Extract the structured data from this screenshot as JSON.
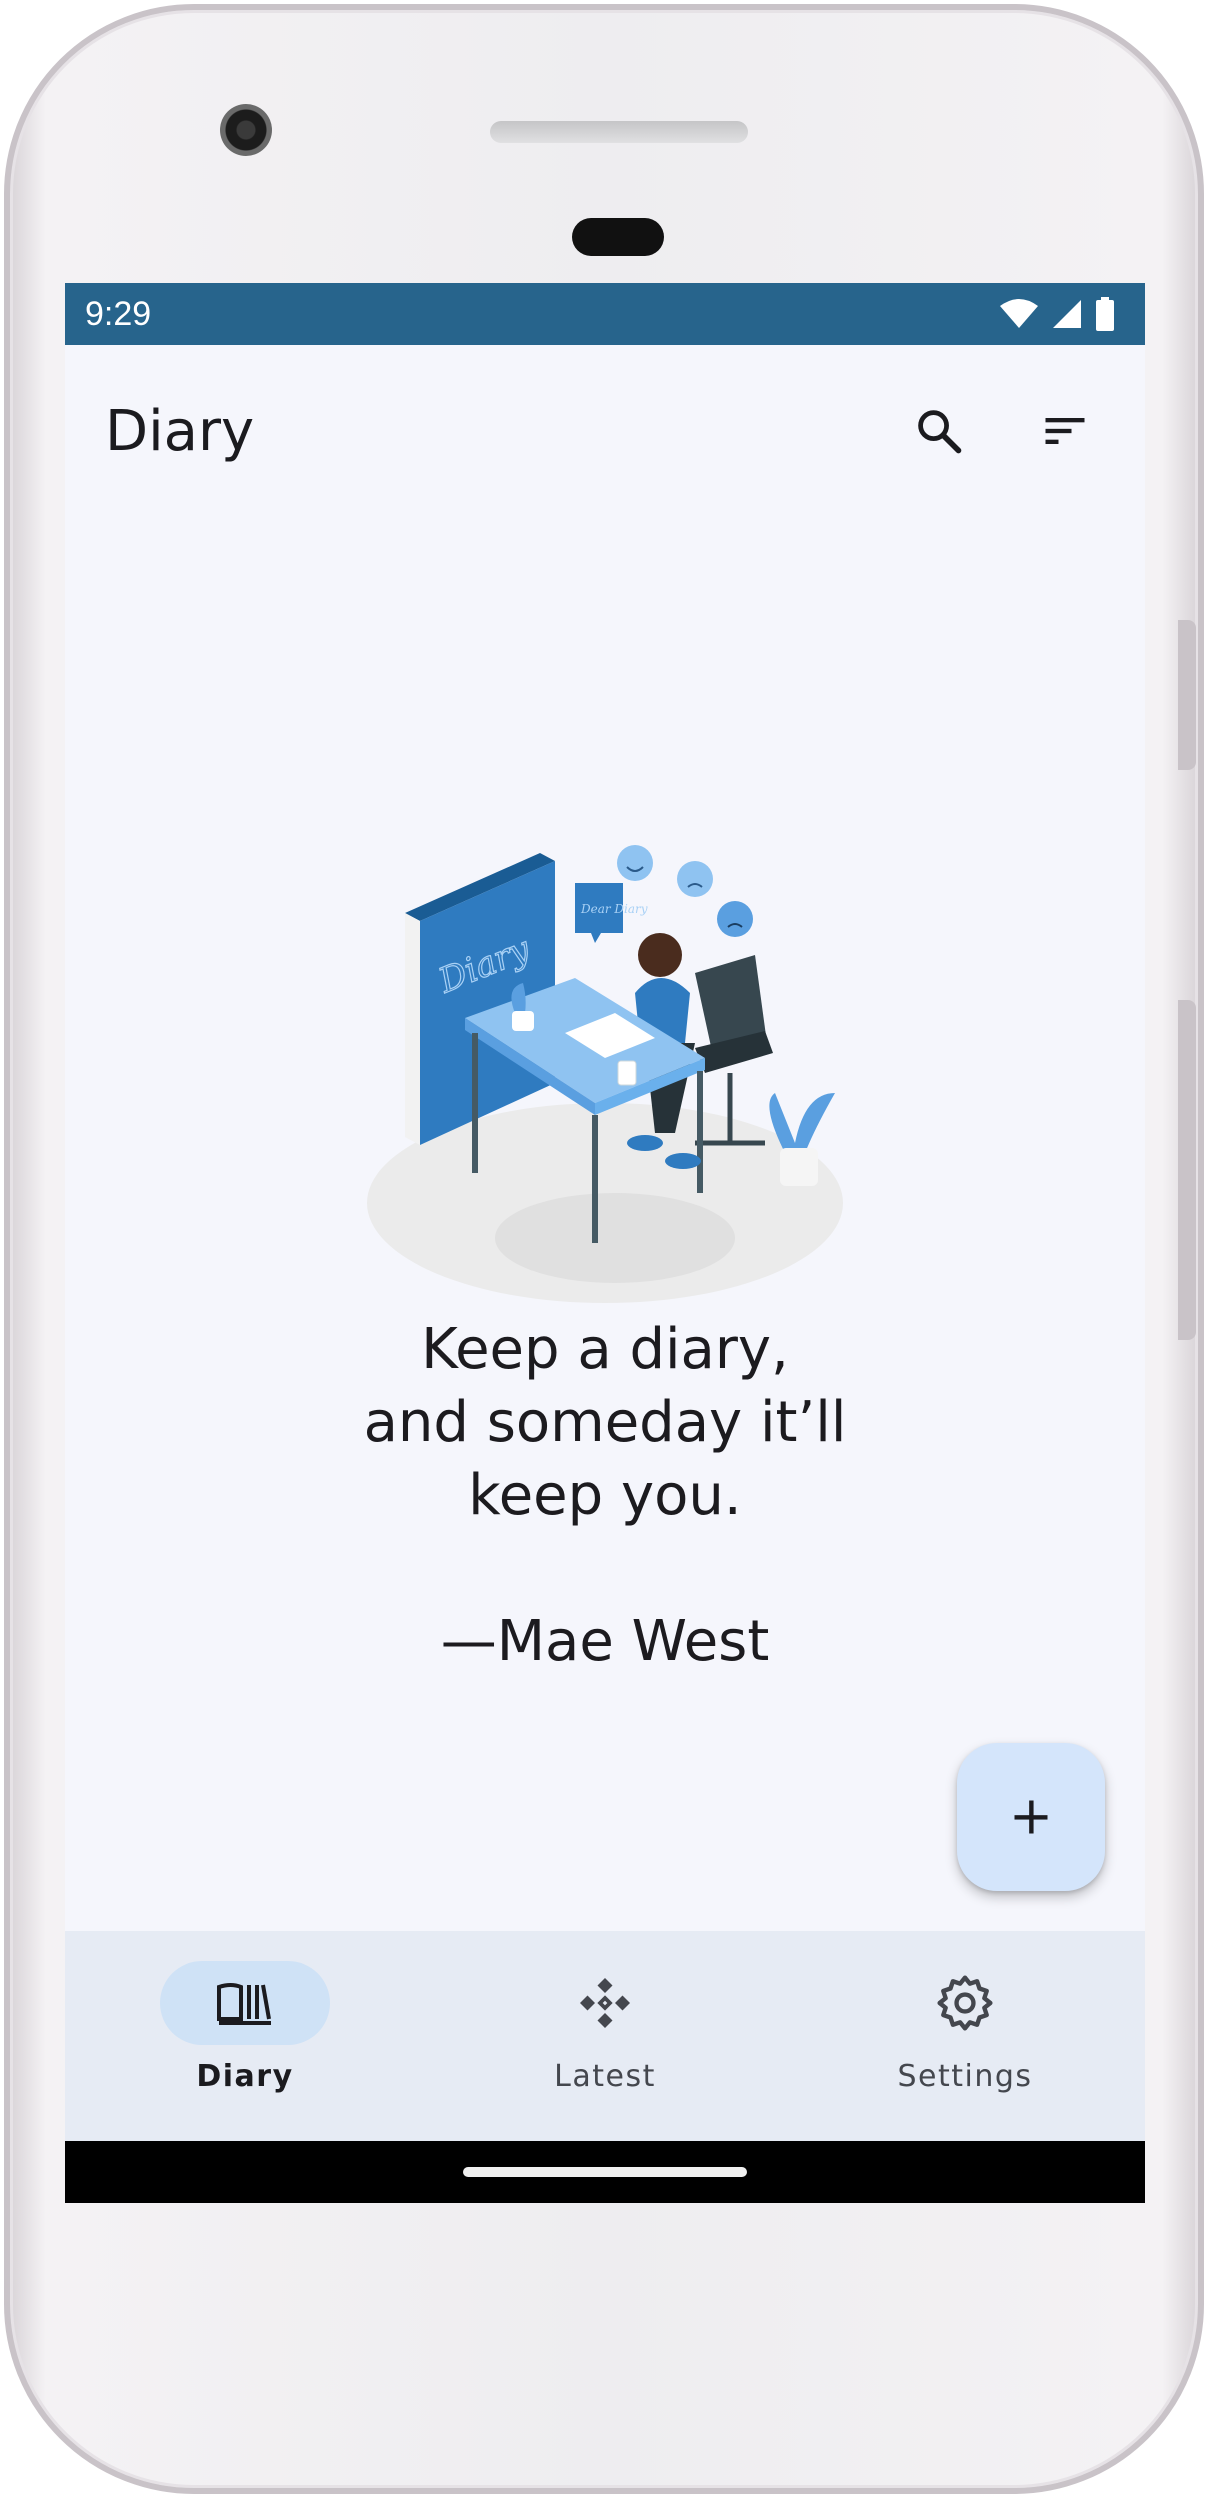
{
  "status_bar": {
    "time": "9:29",
    "icons": [
      "wifi-icon",
      "signal-icon",
      "battery-icon"
    ]
  },
  "app_bar": {
    "title": "Diary",
    "actions": [
      "search-icon",
      "sort-icon"
    ]
  },
  "empty_state": {
    "illustration_label": "Diary",
    "illustration_note": "Dear Diary",
    "quote_lines": [
      "Keep a diary,",
      "and someday it’ll",
      "keep you."
    ],
    "author": "—Mae West"
  },
  "fab": {
    "icon": "plus-icon"
  },
  "bottom_nav": {
    "items": [
      {
        "label": "Diary",
        "icon": "book-icon",
        "active": true
      },
      {
        "label": "Latest",
        "icon": "latest-icon",
        "active": false
      },
      {
        "label": "Settings",
        "icon": "gear-icon",
        "active": false
      }
    ]
  },
  "colors": {
    "status_bar": "#27648c",
    "background": "#f5f6fc",
    "fab": "#d4e5fb",
    "nav_background": "#e6ebf4",
    "nav_indicator": "#cfe2f6"
  }
}
